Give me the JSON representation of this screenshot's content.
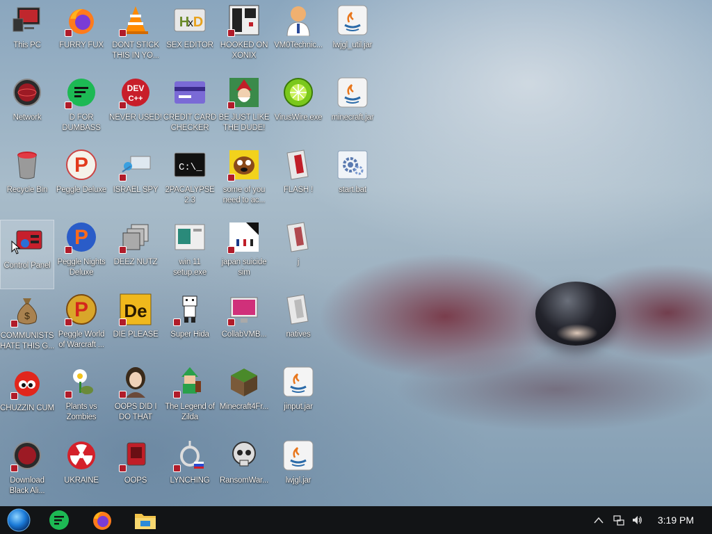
{
  "desktop": {
    "icons": [
      {
        "label": "This PC"
      },
      {
        "label": "Network"
      },
      {
        "label": "Recycle Bin"
      },
      {
        "label": "Control Panel"
      },
      {
        "label": "COMMUNISTS HATE THIS G..."
      },
      {
        "label": "CHUZZIN CUM"
      },
      {
        "label": "Download Black Ali..."
      },
      {
        "label": "FURRY FUX"
      },
      {
        "label": "D FOR DUMBASS"
      },
      {
        "label": "Peggle Deluxe"
      },
      {
        "label": "Peggle Nights Deluxe"
      },
      {
        "label": "Peggle World of Warcraft ..."
      },
      {
        "label": "Plants vs Zombies"
      },
      {
        "label": "UKRAINE"
      },
      {
        "label": "DONT STICK THIS IN YO..."
      },
      {
        "label": "NEVER USED!"
      },
      {
        "label": "ISRAEL SPY"
      },
      {
        "label": "DEEZ NUTZ"
      },
      {
        "label": "DIE PLEASE"
      },
      {
        "label": "OOPS DID I DO THAT"
      },
      {
        "label": "OOPS"
      },
      {
        "label": "SEX EDITOR"
      },
      {
        "label": "CREDIT CARD CHECKER"
      },
      {
        "label": "2PACALYPSE 2.3"
      },
      {
        "label": "win 11 setup.exe"
      },
      {
        "label": "Super Hida"
      },
      {
        "label": "The Legend of Zilda"
      },
      {
        "label": "LYNCHING"
      },
      {
        "label": "HOOKED ON XONIX"
      },
      {
        "label": "BE JUST LIKE THE DUDE!"
      },
      {
        "label": "some of you need to ac..."
      },
      {
        "label": "japan suicide sim"
      },
      {
        "label": "CollabVMB..."
      },
      {
        "label": "Minecraft4Fr..."
      },
      {
        "label": "RansomWar..."
      },
      {
        "label": "VM0Technic..."
      },
      {
        "label": "VirusWire.exe"
      },
      {
        "label": "FLASH !"
      },
      {
        "label": "j"
      },
      {
        "label": "natives"
      },
      {
        "label": "jinput.jar"
      },
      {
        "label": "lwjgl.jar"
      },
      {
        "label": "lwjgl_util.jar"
      },
      {
        "label": "minecraft.jar"
      },
      {
        "label": "start.bat"
      }
    ]
  },
  "taskbar": {
    "clock": "3:19 PM"
  },
  "colors": {
    "taskbar_bg": "#121416",
    "shortcut_arrow": "#b01c2a",
    "label_text": "#ffffff"
  }
}
